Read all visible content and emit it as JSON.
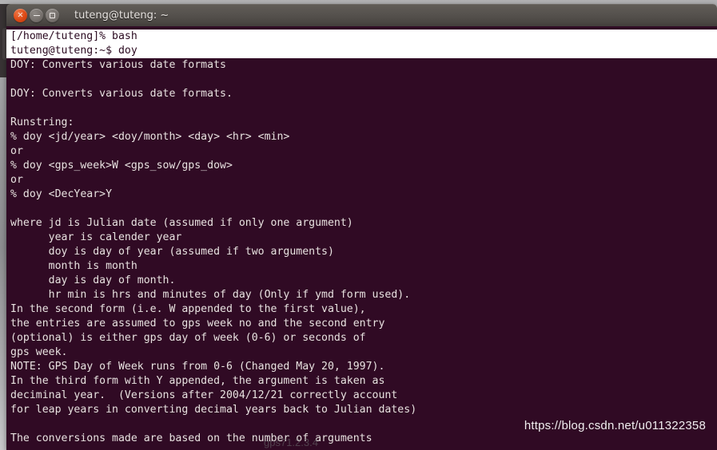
{
  "window": {
    "title": "tuteng@tuteng: ~",
    "controls": {
      "close_label": "×",
      "minimize_label": "−",
      "maximize_label": "□"
    },
    "colors": {
      "terminal_background": "#300a24",
      "terminal_foreground": "#e8e2e0",
      "titlebar": "#4b4743",
      "close_button": "#dd4814",
      "prompt_block_background": "#ffffff",
      "prompt_block_foreground": "#2b0a20"
    }
  },
  "terminal": {
    "prompt_lines": [
      "[/home/tuteng]% bash",
      "tuteng@tuteng:~$ doy"
    ],
    "output_lines": [
      "DOY: Converts various date formats",
      "",
      "DOY: Converts various date formats.",
      "",
      "Runstring:",
      "% doy <jd/year> <doy/month> <day> <hr> <min>",
      "or",
      "% doy <gps_week>W <gps_sow/gps_dow>",
      "or",
      "% doy <DecYear>Y",
      "",
      "where jd is Julian date (assumed if only one argument)",
      "      year is calender year",
      "      doy is day of year (assumed if two arguments)",
      "      month is month",
      "      day is day of month.",
      "      hr min is hrs and minutes of day (Only if ymd form used).",
      "In the second form (i.e. W appended to the first value),",
      "the entries are assumed to gps week no and the second entry",
      "(optional) is either gps day of week (0-6) or seconds of",
      "gps week.",
      "NOTE: GPS Day of Week runs from 0-6 (Changed May 20, 1997).",
      "In the third form with Y appended, the argument is taken as",
      "deciminal year.  (Versions after 2004/12/21 correctly account",
      "for leap years in converting decimal years back to Julian dates)",
      "",
      "The conversions made are based on the number of arguments"
    ]
  },
  "watermark": {
    "url": "https://blog.csdn.net/u011322358",
    "ghost": "gps71.2.3.4"
  }
}
